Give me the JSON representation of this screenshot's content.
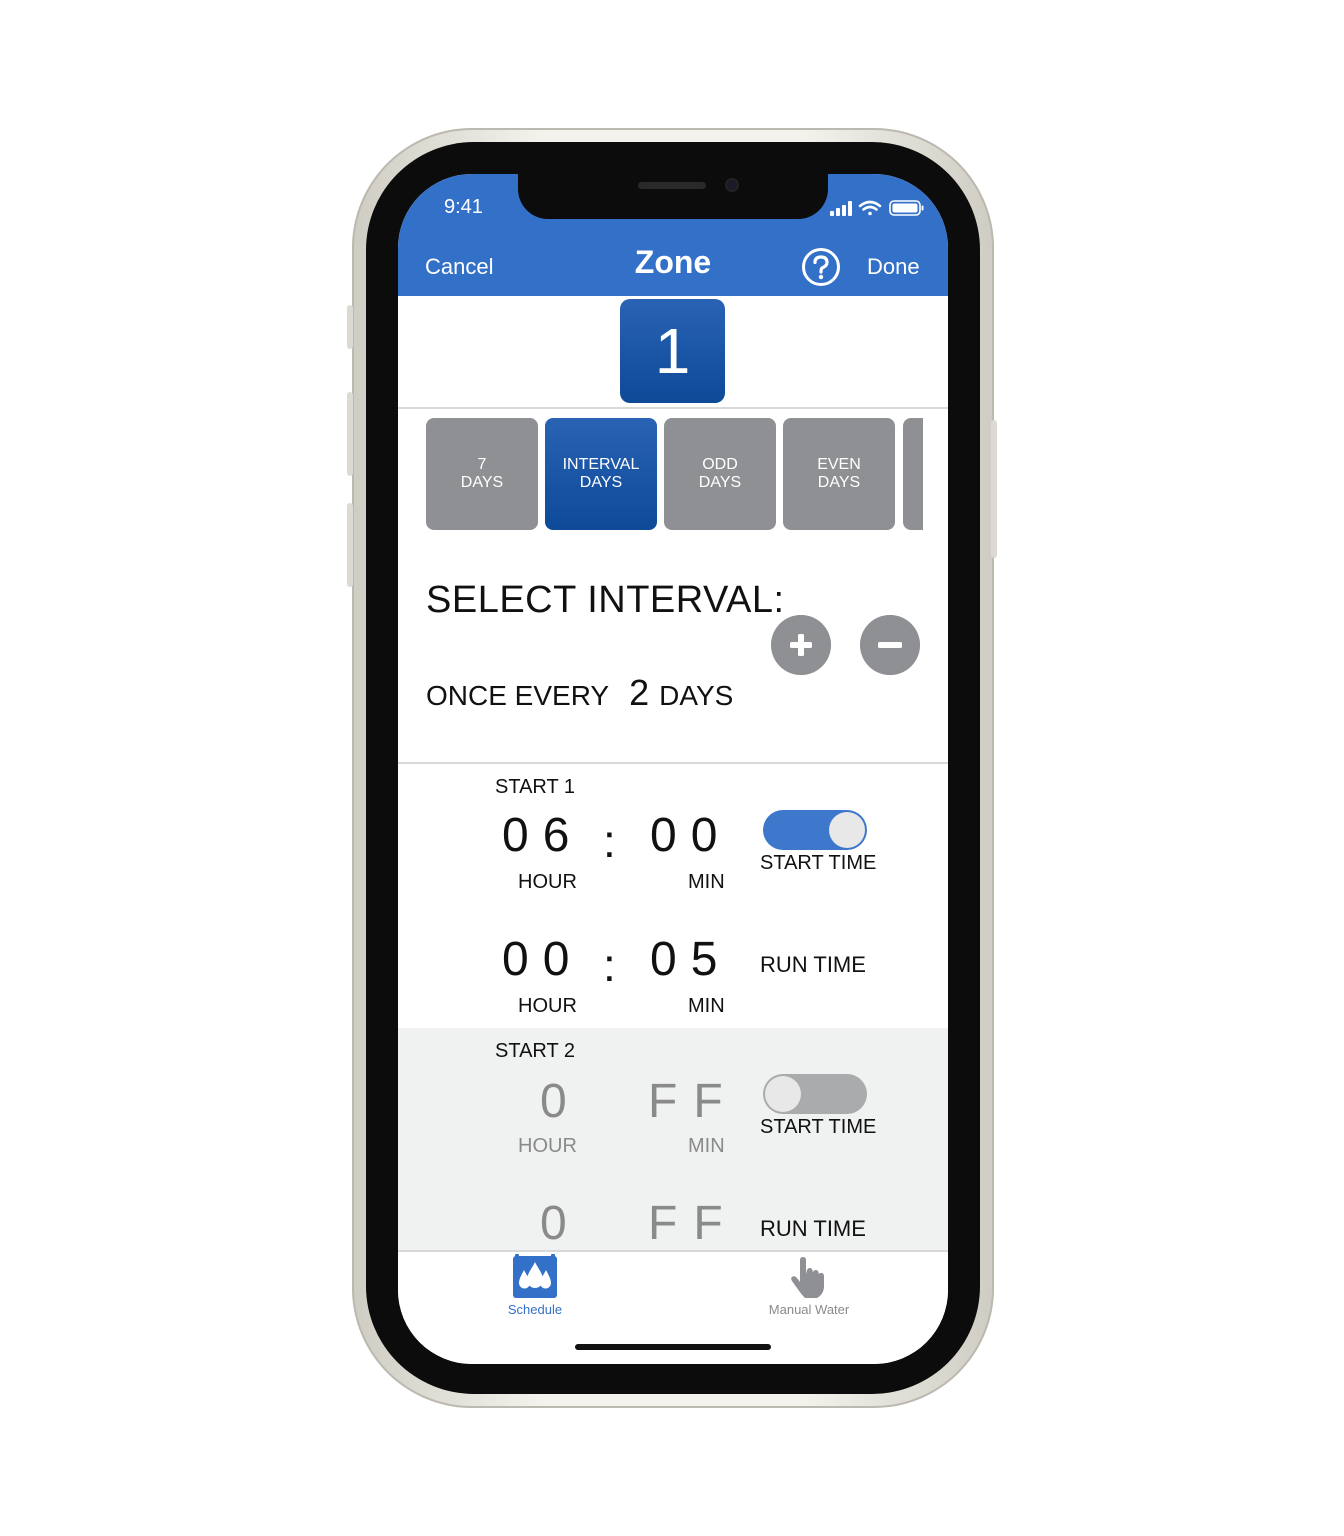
{
  "status_bar": {
    "time": "9:41"
  },
  "nav": {
    "cancel_label": "Cancel",
    "title": "Zone",
    "done_label": "Done"
  },
  "zone": {
    "number": "1"
  },
  "schedule_tabs": [
    {
      "line1": "7",
      "line2": "DAYS"
    },
    {
      "line1": "INTERVAL",
      "line2": "DAYS"
    },
    {
      "line1": "ODD",
      "line2": "DAYS"
    },
    {
      "line1": "EVEN",
      "line2": "DAYS"
    }
  ],
  "interval": {
    "heading": "SELECT INTERVAL:",
    "prefix": "ONCE EVERY",
    "value": "2",
    "suffix": "DAYS"
  },
  "start1": {
    "label": "START 1",
    "start_hour": "06",
    "start_min": "00",
    "run_hour": "00",
    "run_min": "05",
    "colon": ":",
    "hour_label": "HOUR",
    "min_label": "MIN",
    "start_time_label": "START TIME",
    "run_time_label": "RUN TIME",
    "enabled": true
  },
  "start2": {
    "label": "START 2",
    "start_hour": "0",
    "start_min": "FF",
    "run_hour": "0",
    "run_min": "FF",
    "hour_label": "HOUR",
    "min_label": "MIN",
    "start_time_label": "START TIME",
    "run_time_label": "RUN TIME",
    "enabled": false
  },
  "tabbar": {
    "schedule_label": "Schedule",
    "manual_label": "Manual Water"
  },
  "colors": {
    "primary": "#3370c8",
    "dark_blue": "#0d4a98",
    "gray": "#8e9094",
    "toggle_on": "#3d78cc",
    "toggle_off": "#a9abac"
  },
  "icons": [
    "signal-icon",
    "wifi-icon",
    "battery-icon",
    "help-icon",
    "plus-icon",
    "minus-icon",
    "water-drops-icon",
    "hand-pointer-icon"
  ]
}
